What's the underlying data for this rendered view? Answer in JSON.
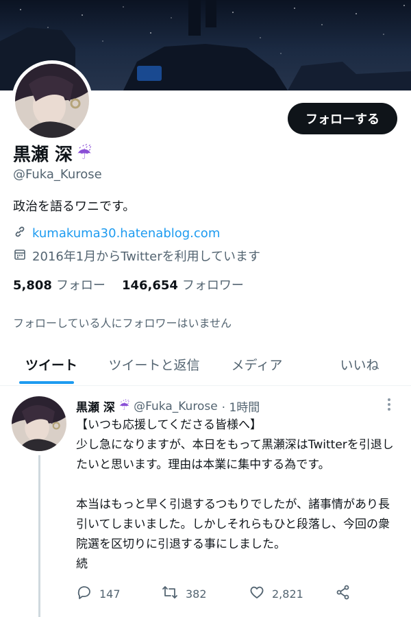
{
  "profile": {
    "display_name": "黒瀬 深",
    "name_emoji": "☔",
    "handle": "@Fuka_Kurose",
    "bio": "政治を語るワニです。",
    "link": "kumakuma30.hatenablog.com",
    "joined": "2016年1月からTwitterを利用しています",
    "following_count": "5,808",
    "following_label": "フォロー",
    "followers_count": "146,654",
    "followers_label": "フォロワー",
    "followers_note": "フォローしている人にフォロワーはいません",
    "follow_button": "フォローする"
  },
  "tabs": [
    {
      "label": "ツイート"
    },
    {
      "label": "ツイートと返信"
    },
    {
      "label": "メディア"
    },
    {
      "label": "いいね"
    }
  ],
  "tweet": {
    "name": "黒瀬 深",
    "name_emoji": "☔",
    "handle": "@Fuka_Kurose",
    "time": "· 1時間",
    "body": "【いつも応援してくださる皆様へ】\n少し急になりますが、本日をもって黒瀬深はTwitterを引退したいと思います。理由は本業に集中する為です。\n\n本当はもっと早く引退するつもりでしたが、諸事情があり長引いてしまいました。しかしそれらもひと段落し、今回の衆院選を区切りに引退する事にしました。\n続",
    "replies": "147",
    "retweets": "382",
    "likes": "2,821"
  },
  "icons": {
    "link": "link-icon",
    "calendar": "calendar-icon",
    "reply": "reply-icon",
    "retweet": "retweet-icon",
    "like": "heart-icon",
    "share": "share-icon",
    "more": "more-icon"
  },
  "colors": {
    "accent": "#1d9bf0",
    "text": "#0f1419",
    "secondary": "#536471",
    "button_bg": "#0f1419"
  }
}
